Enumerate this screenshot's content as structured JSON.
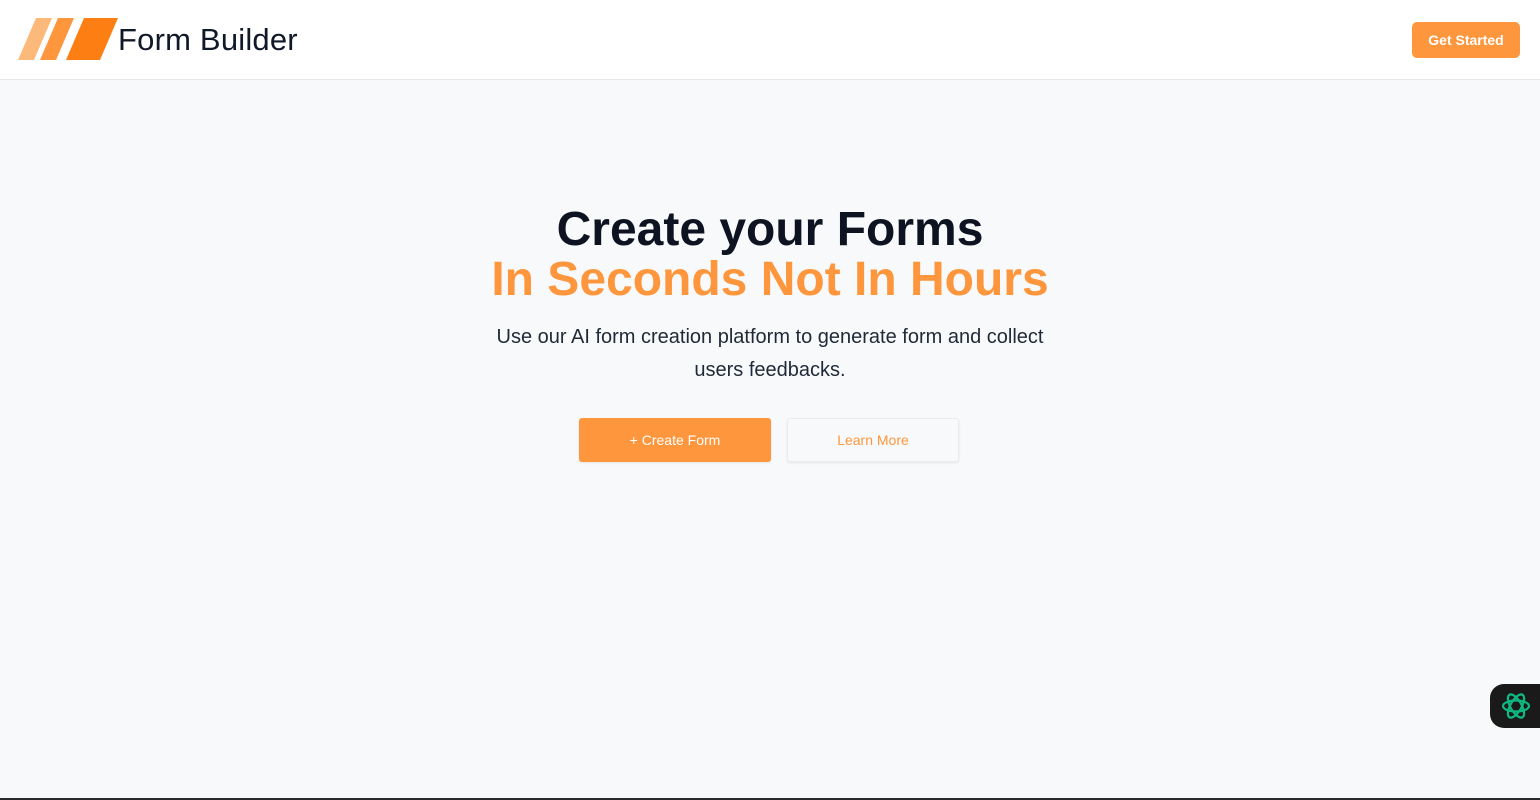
{
  "header": {
    "brand_name": "Form Builder",
    "cta_label": "Get Started",
    "logo_icon": "slanted-stripes-logo-icon"
  },
  "hero": {
    "title": "Create your Forms",
    "subtitle": "In Seconds Not In Hours",
    "description": "Use our AI form creation platform to generate form and collect users feedbacks."
  },
  "actions": {
    "create_form_label": "+ Create Form",
    "learn_more_label": "Learn More"
  },
  "widget": {
    "icon": "ai-assistant-icon"
  },
  "colors": {
    "accent": "#fd963c",
    "accent_light": "#fdb97a",
    "title": "#0d1321",
    "background": "#f8f9fa",
    "header_bg": "#ffffff",
    "widget_bg": "#1a1a1a",
    "widget_icon": "#10b981"
  }
}
